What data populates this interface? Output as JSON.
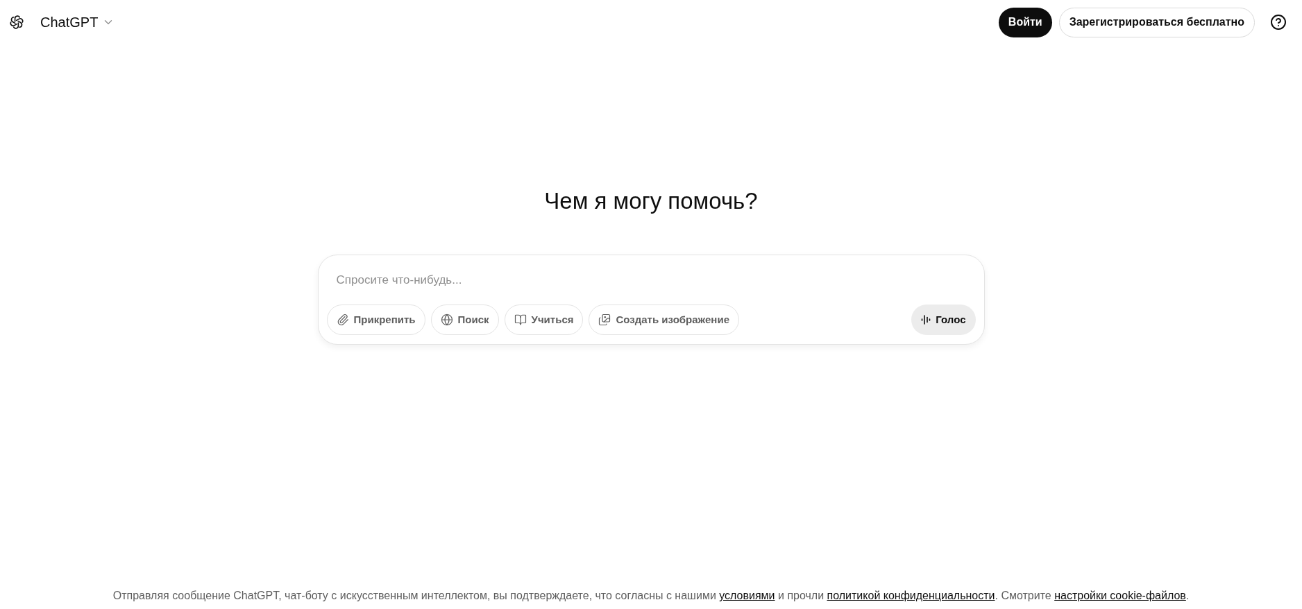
{
  "header": {
    "model_menu": "ChatGPT",
    "login_button": "Войти",
    "signup_button": "Зарегистрироваться бесплатно"
  },
  "heading": "Чем я могу помочь?",
  "composer": {
    "placeholder": "Спросите что-нибудь...",
    "tools": [
      {
        "label": "Прикрепить"
      },
      {
        "label": "Поиск"
      },
      {
        "label": "Учиться"
      },
      {
        "label": "Создать изображение"
      }
    ],
    "voice_button": "Голос"
  },
  "footer": {
    "parts": [
      {
        "kind": "text",
        "text": "Отправляя сообщение ChatGPT, чат-боту с искусственным интеллектом, вы подтверждаете, что согласны с нашими "
      },
      {
        "kind": "link",
        "text": "условиями"
      },
      {
        "kind": "text",
        "text": " и прочли "
      },
      {
        "kind": "link",
        "text": "политикой конфиденциальности"
      },
      {
        "kind": "text",
        "text": ". Смотрите "
      },
      {
        "kind": "link",
        "text": "настройки cookie-файлов"
      },
      {
        "kind": "text",
        "text": "."
      }
    ]
  }
}
